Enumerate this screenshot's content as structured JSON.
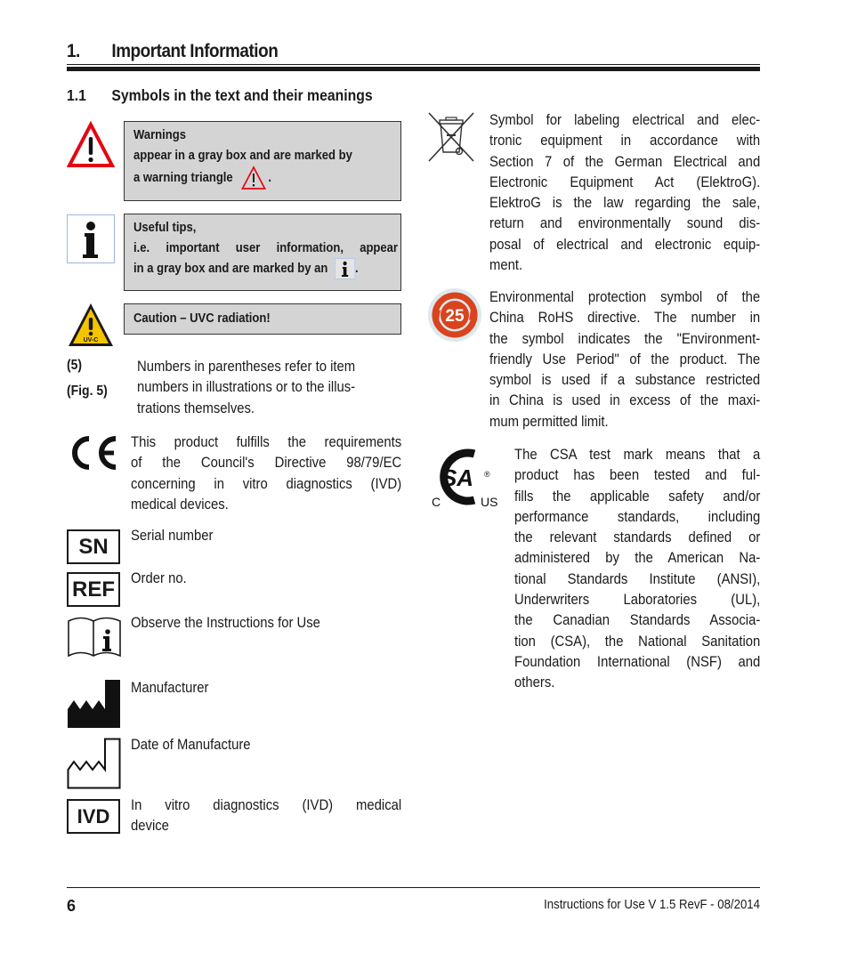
{
  "header": {
    "chapter_number": "1.",
    "chapter_title": "Important Information",
    "section_number": "1.1",
    "section_title": "Symbols in the text and their meanings"
  },
  "left_column": {
    "warning_box": {
      "icon": "warning-triangle-icon",
      "title": "Warnings",
      "line1": "appear in a gray box and are marked by",
      "line2": "a warning triangle",
      "suffix": ".",
      "accent_color": "#e30613"
    },
    "tips_box": {
      "icon": "info-icon",
      "title": "Useful tips,",
      "line1": "i.e. important user information, appear",
      "line2": "in a gray box and are marked by an",
      "suffix": "."
    },
    "uvc_box": {
      "icon": "uvc-warning-icon",
      "icon_label": "UV-C",
      "text": "Caution – UVC radiation!",
      "accent_color": "#f5c400"
    },
    "numbers_ref": {
      "label1": "(5)",
      "label2": "(Fig. 5)",
      "lines": [
        "Numbers in parentheses refer to item",
        "numbers in illustrations or to the illus-",
        "trations themselves."
      ]
    },
    "ce_mark": {
      "icon": "ce-mark-icon",
      "icon_text": "CE",
      "lines": [
        "This product fulfills the requirements",
        "of the Council's Directive 98/79/EC",
        "concerning in vitro diagnostics (IVD)",
        "medical devices."
      ]
    },
    "symbols": [
      {
        "icon": "serial-number-icon",
        "icon_text": "SN",
        "label": "Serial number"
      },
      {
        "icon": "order-number-icon",
        "icon_text": "REF",
        "label": "Order no."
      },
      {
        "icon": "instructions-for-use-icon",
        "label": "Observe the Instructions for Use"
      },
      {
        "icon": "manufacturer-icon",
        "label": "Manufacturer"
      },
      {
        "icon": "date-of-manufacture-icon",
        "label": "Date of Manufacture"
      },
      {
        "icon": "ivd-icon",
        "icon_text": "IVD",
        "label_line1": "In vitro diagnostics (IVD) medical",
        "label_line2": "device"
      }
    ]
  },
  "right_column": {
    "weee": {
      "icon": "crossed-bin-icon",
      "lines": [
        "Symbol for labeling electrical and elec-",
        "tronic equipment in accordance with",
        "Section 7 of the German Electrical and",
        "Electronic Equipment Act (ElektroG).",
        "ElektroG is the law regarding the sale,",
        "return and environmentally sound dis-",
        "posal of electrical and electronic equip-",
        "ment."
      ]
    },
    "china_rohs": {
      "icon": "china-rohs-icon",
      "icon_text": "25",
      "accent_color": "#d9431e",
      "lines": [
        "Environmental protection symbol of the",
        "China RoHS directive. The number in",
        "the symbol indicates the \"Environment-",
        "friendly Use Period\" of the product. The",
        "symbol is used if a substance restricted",
        "in China is used in excess of the maxi-",
        "mum permitted limit."
      ]
    },
    "csa": {
      "icon": "csa-mark-icon",
      "icon_left": "C",
      "icon_right": "US",
      "registered": "®",
      "lines": [
        "The CSA test mark means that a",
        "product has been tested and ful-",
        "fills the applicable safety and/or",
        "performance standards, including",
        "the relevant standards defined or",
        "administered by the American Na-",
        "tional Standards Institute (ANSI),",
        "Underwriters Laboratories (UL),",
        "the Canadian Standards Associa-",
        "tion (CSA), the National Sanitation",
        "Foundation International (NSF) and",
        "others."
      ]
    }
  },
  "footer": {
    "page_number": "6",
    "document_info": "Instructions for Use V 1.5 RevF - 08/2014"
  }
}
